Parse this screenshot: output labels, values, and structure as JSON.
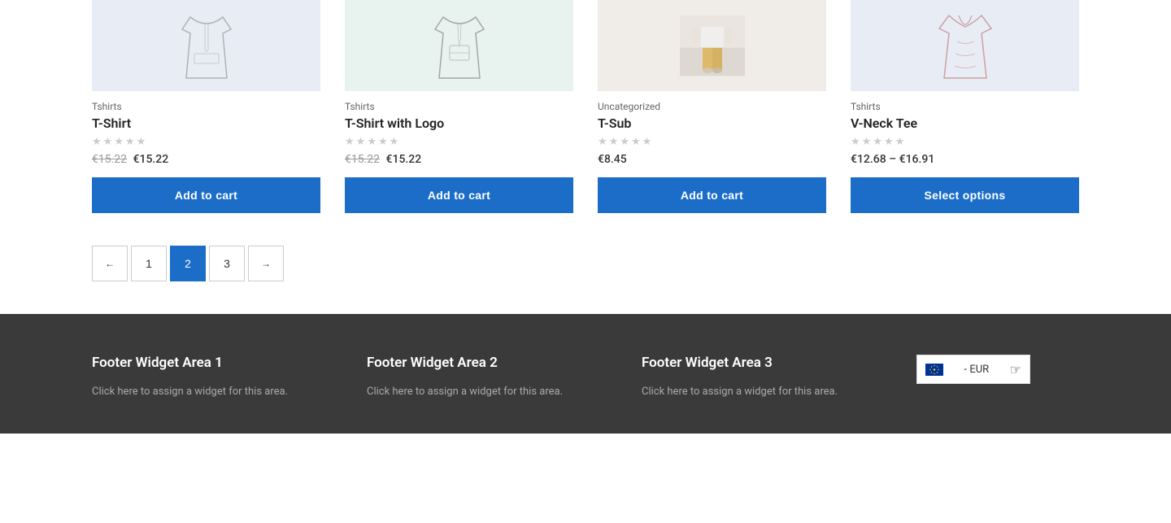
{
  "products": [
    {
      "id": 1,
      "category": "Tshirts",
      "name": "T-Shirt",
      "stars": [
        0,
        0,
        0,
        0,
        0
      ],
      "price_original": "€15.22",
      "price_current": "€15.22",
      "price_type": "sale",
      "btn_label": "Add to cart",
      "image_type": "tshirt-plain"
    },
    {
      "id": 2,
      "category": "Tshirts",
      "name": "T-Shirt with Logo",
      "stars": [
        0,
        0,
        0,
        0,
        0
      ],
      "price_original": "€15.22",
      "price_current": "€15.22",
      "price_type": "sale",
      "btn_label": "Add to cart",
      "image_type": "tshirt-logo"
    },
    {
      "id": 3,
      "category": "Uncategorized",
      "name": "T-Sub",
      "stars": [
        0,
        0,
        0,
        0,
        0
      ],
      "price_current": "€8.45",
      "price_type": "single",
      "btn_label": "Add to cart",
      "image_type": "tshirt-photo"
    },
    {
      "id": 4,
      "category": "Tshirts",
      "name": "V-Neck Tee",
      "stars": [
        0,
        0,
        0,
        0,
        0
      ],
      "price_range": "€12.68 – €16.91",
      "price_type": "range",
      "btn_label": "Select options",
      "image_type": "tshirt-vneck"
    }
  ],
  "pagination": {
    "prev_label": "←",
    "next_label": "→",
    "pages": [
      "1",
      "2",
      "3"
    ],
    "current": "2"
  },
  "footer": {
    "widget1": {
      "title": "Footer Widget Area 1",
      "text": "Click here to assign a widget for this area."
    },
    "widget2": {
      "title": "Footer Widget Area 2",
      "text": "Click here to assign a widget for this area."
    },
    "widget3": {
      "title": "Footer Widget Area 3",
      "text": "Click here to assign a widget for this area."
    },
    "currency": {
      "label": "- EUR",
      "flag": "EU"
    }
  }
}
